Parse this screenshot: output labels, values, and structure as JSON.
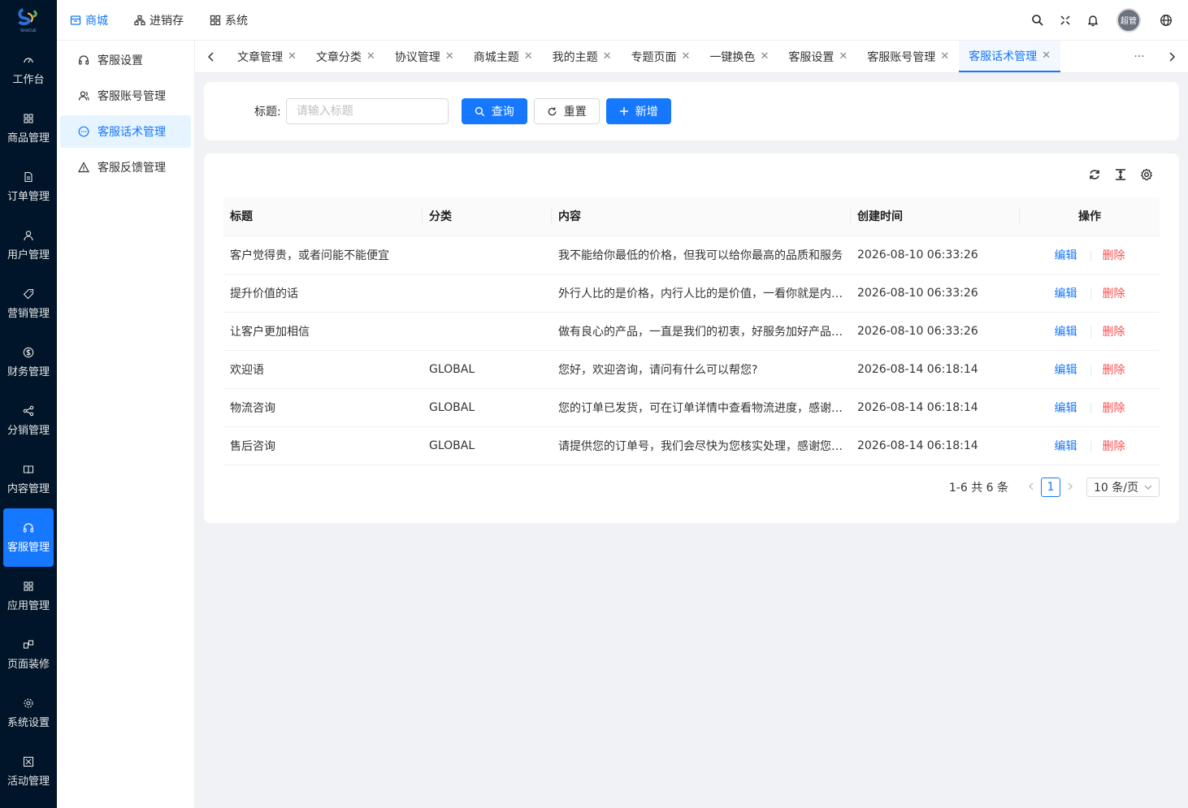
{
  "logo": {
    "text": "SHUCUE"
  },
  "rail": {
    "items": [
      {
        "label": "工作台",
        "icon": "dashboard-icon"
      },
      {
        "label": "商品管理",
        "icon": "grid-icon"
      },
      {
        "label": "订单管理",
        "icon": "document-icon"
      },
      {
        "label": "用户管理",
        "icon": "user-icon"
      },
      {
        "label": "营销管理",
        "icon": "tag-icon"
      },
      {
        "label": "财务管理",
        "icon": "dollar-icon"
      },
      {
        "label": "分销管理",
        "icon": "share-icon"
      },
      {
        "label": "内容管理",
        "icon": "book-icon"
      },
      {
        "label": "客服管理",
        "icon": "headset-icon",
        "active": true
      },
      {
        "label": "应用管理",
        "icon": "apps-icon"
      },
      {
        "label": "页面装修",
        "icon": "layout-icon"
      },
      {
        "label": "系统设置",
        "icon": "gear-icon"
      },
      {
        "label": "活动管理",
        "icon": "activity-icon"
      }
    ]
  },
  "topnav": {
    "items": [
      {
        "label": "商城",
        "active": true
      },
      {
        "label": "进销存"
      },
      {
        "label": "系统"
      }
    ],
    "avatar": "超管"
  },
  "submenu": {
    "items": [
      {
        "label": "客服设置"
      },
      {
        "label": "客服账号管理"
      },
      {
        "label": "客服话术管理",
        "active": true
      },
      {
        "label": "客服反馈管理"
      }
    ]
  },
  "tabs": {
    "items": [
      "文章管理",
      "文章分类",
      "协议管理",
      "商城主题",
      "我的主题",
      "专题页面",
      "一键换色",
      "客服设置",
      "客服账号管理",
      "客服话术管理"
    ],
    "active_index": 9,
    "more": "···"
  },
  "search": {
    "label": "标题:",
    "placeholder": "请输入标题",
    "query_label": "查询",
    "reset_label": "重置",
    "add_label": "新增"
  },
  "table": {
    "columns": [
      "标题",
      "分类",
      "内容",
      "创建时间",
      "操作"
    ],
    "rows": [
      {
        "title": "客户觉得贵，或者问能不能便宜",
        "category": "",
        "content": "我不能给你最低的价格，但我可以给你最高的品质和服务",
        "created": "2026-08-10 06:33:26"
      },
      {
        "title": "提升价值的话",
        "category": "",
        "content": "外行人比的是价格，内行人比的是价值，一看你就是内行人",
        "created": "2026-08-10 06:33:26"
      },
      {
        "title": "让客户更加相信",
        "category": "",
        "content": "做有良心的产品，一直是我们的初衷，好服务加好产品才是王道",
        "created": "2026-08-10 06:33:26"
      },
      {
        "title": "欢迎语",
        "category": "GLOBAL",
        "content": "您好，欢迎咨询，请问有什么可以帮您?",
        "created": "2026-08-14 06:18:14"
      },
      {
        "title": "物流咨询",
        "category": "GLOBAL",
        "content": "您的订单已发货，可在订单详情中查看物流进度，感谢您的耐心等待",
        "created": "2026-08-14 06:18:14"
      },
      {
        "title": "售后咨询",
        "category": "GLOBAL",
        "content": "请提供您的订单号，我们会尽快为您核实处理，感谢您的支持",
        "created": "2026-08-14 06:18:14"
      }
    ],
    "edit_label": "编辑",
    "delete_label": "删除"
  },
  "pagination": {
    "total_text": "1-6 共 6 条",
    "current_page": "1",
    "page_size": "10 条/页"
  },
  "colors": {
    "primary": "#1677ff",
    "danger": "#ff4d4f",
    "rail_bg": "#001529"
  }
}
